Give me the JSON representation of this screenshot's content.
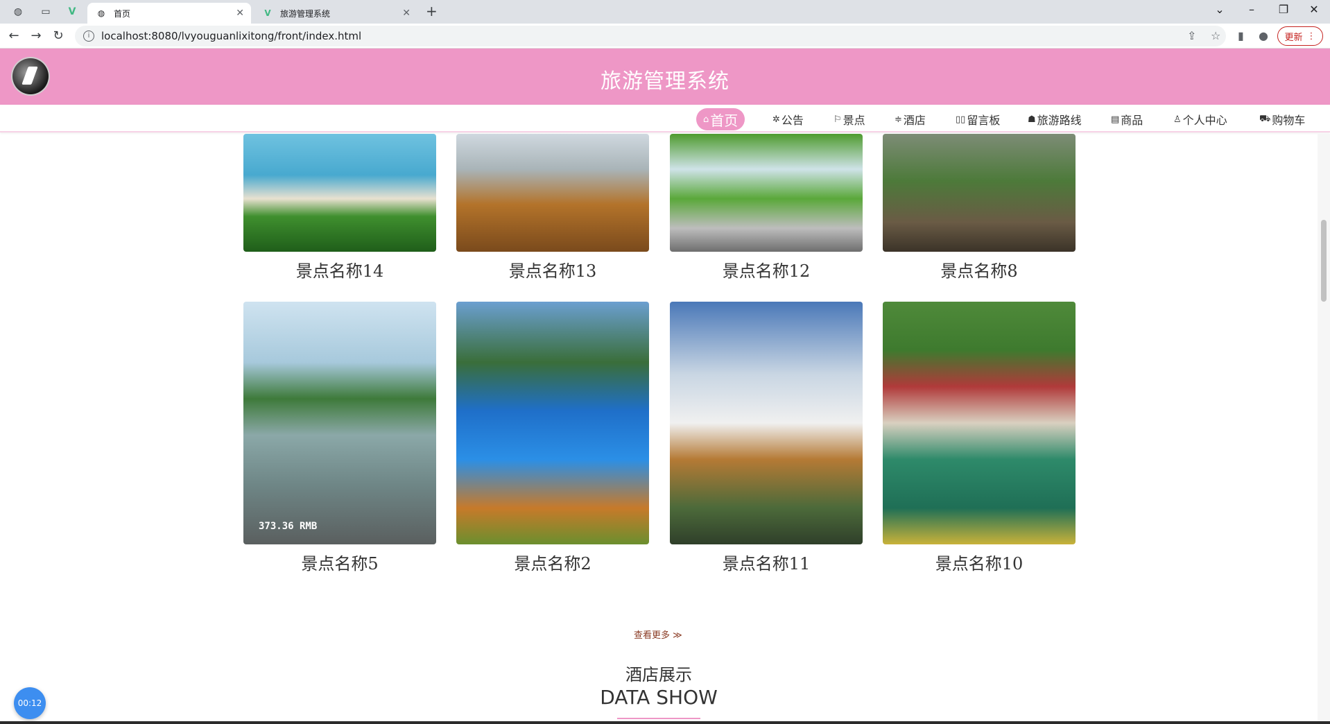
{
  "browser": {
    "tabs": [
      {
        "title": "首页",
        "active": true
      },
      {
        "title": "旅游管理系统",
        "active": false
      }
    ],
    "url": "localhost:8080/lvyouguanlixitong/front/index.html",
    "update_label": "更新"
  },
  "site": {
    "title": "旅游管理系统",
    "nav": [
      {
        "label": "首页",
        "icon": "home-icon",
        "active": true
      },
      {
        "label": "公告",
        "icon": "announcement-icon",
        "active": false
      },
      {
        "label": "景点",
        "icon": "flag-icon",
        "active": false
      },
      {
        "label": "酒店",
        "icon": "sliders-icon",
        "active": false
      },
      {
        "label": "留言板",
        "icon": "message-icon",
        "active": false
      },
      {
        "label": "旅游路线",
        "icon": "route-icon",
        "active": false
      },
      {
        "label": "商品",
        "icon": "goods-icon",
        "active": false
      },
      {
        "label": "个人中心",
        "icon": "user-icon",
        "active": false
      },
      {
        "label": "购物车",
        "icon": "cart-icon",
        "active": false
      }
    ]
  },
  "attractions": {
    "row1": [
      "景点名称14",
      "景点名称13",
      "景点名称12",
      "景点名称8"
    ],
    "row2": [
      "景点名称5",
      "景点名称2",
      "景点名称11",
      "景点名称10"
    ],
    "price_overlay": "373.36 RMB",
    "more_label": "查看更多 ≫"
  },
  "hotel_section": {
    "title": "酒店展示",
    "subtitle": "DATA SHOW"
  },
  "timer": "00:12",
  "colors": {
    "brand_pink": "#ee97c6"
  }
}
